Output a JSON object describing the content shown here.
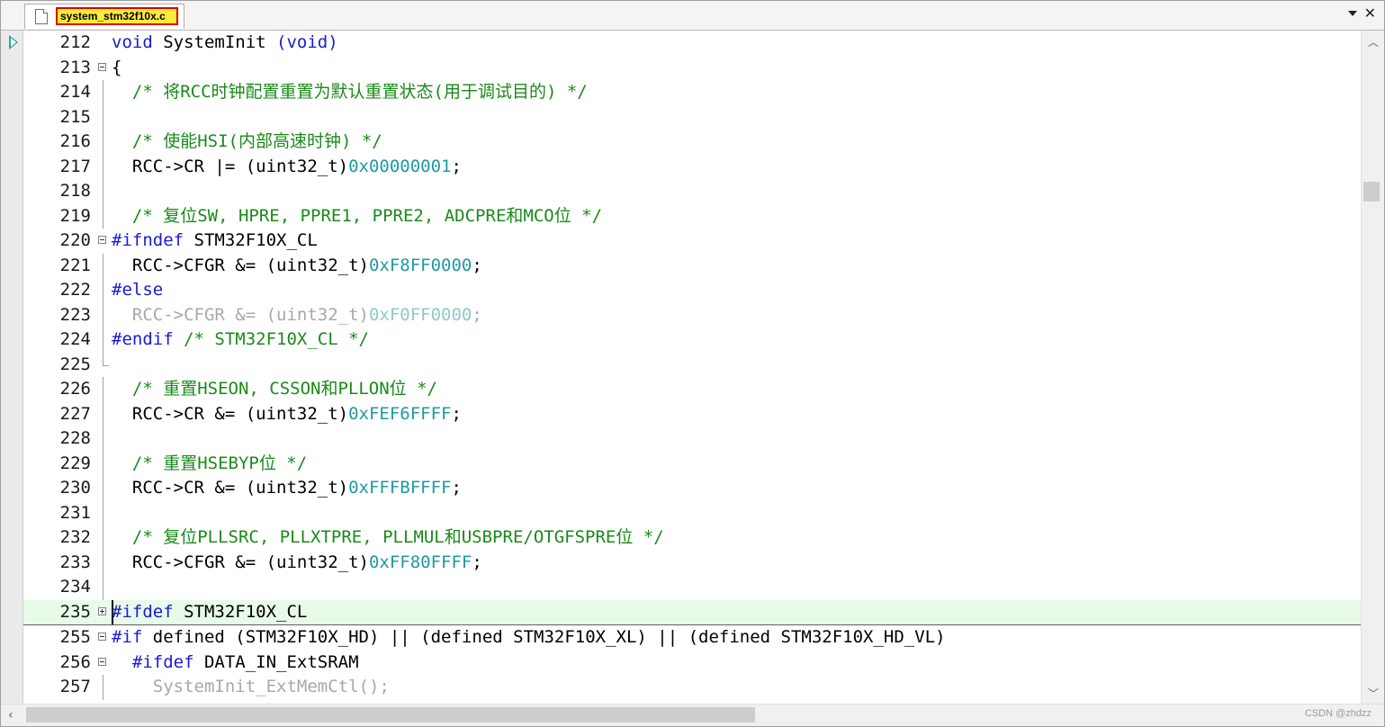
{
  "tab": {
    "filename": "system_stm32f10x.c",
    "icon": "file-icon"
  },
  "lines": [
    {
      "no": "212",
      "fold": "",
      "tokens": [
        [
          "kw",
          "void"
        ],
        [
          "t",
          " SystemInit "
        ],
        [
          "kw",
          "(void)"
        ]
      ]
    },
    {
      "no": "213",
      "fold": "minus",
      "tokens": [
        [
          "t",
          "{"
        ]
      ]
    },
    {
      "no": "214",
      "fold": "line",
      "tokens": [
        [
          "t",
          "  "
        ],
        [
          "cm",
          "/* 将RCC时钟配置重置为默认重置状态(用于调试目的) */"
        ]
      ]
    },
    {
      "no": "215",
      "fold": "line",
      "tokens": []
    },
    {
      "no": "216",
      "fold": "line",
      "tokens": [
        [
          "t",
          "  "
        ],
        [
          "cm",
          "/* 使能HSI(内部高速时钟) */"
        ]
      ]
    },
    {
      "no": "217",
      "fold": "line",
      "tokens": [
        [
          "t",
          "  RCC->CR |= (uint32_t)"
        ],
        [
          "num",
          "0x00000001"
        ],
        [
          "t",
          ";"
        ]
      ]
    },
    {
      "no": "218",
      "fold": "line",
      "tokens": []
    },
    {
      "no": "219",
      "fold": "line",
      "tokens": [
        [
          "t",
          "  "
        ],
        [
          "cm",
          "/* 复位SW, HPRE, PPRE1, PPRE2, ADCPRE和MCO位 */"
        ]
      ]
    },
    {
      "no": "220",
      "fold": "minus",
      "tokens": [
        [
          "pp",
          "#ifndef"
        ],
        [
          "t",
          " STM32F10X_CL"
        ]
      ]
    },
    {
      "no": "221",
      "fold": "line",
      "tokens": [
        [
          "t",
          "  RCC->CFGR &= (uint32_t)"
        ],
        [
          "num",
          "0xF8FF0000"
        ],
        [
          "t",
          ";"
        ]
      ]
    },
    {
      "no": "222",
      "fold": "line",
      "tokens": [
        [
          "pp",
          "#else"
        ]
      ]
    },
    {
      "no": "223",
      "fold": "line",
      "tokens": [
        [
          "dim",
          "  RCC->CFGR &= (uint32_t)"
        ],
        [
          "dimnum",
          "0xF0FF0000"
        ],
        [
          "dim",
          ";"
        ]
      ]
    },
    {
      "no": "224",
      "fold": "line",
      "tokens": [
        [
          "pp",
          "#endif"
        ],
        [
          "t",
          " "
        ],
        [
          "cm",
          "/* STM32F10X_CL */"
        ]
      ]
    },
    {
      "no": "225",
      "fold": "end",
      "tokens": []
    },
    {
      "no": "226",
      "fold": "line",
      "tokens": [
        [
          "t",
          "  "
        ],
        [
          "cm",
          "/* 重置HSEON, CSSON和PLLON位 */"
        ]
      ]
    },
    {
      "no": "227",
      "fold": "line",
      "tokens": [
        [
          "t",
          "  RCC->CR &= (uint32_t)"
        ],
        [
          "num",
          "0xFEF6FFFF"
        ],
        [
          "t",
          ";"
        ]
      ]
    },
    {
      "no": "228",
      "fold": "line",
      "tokens": []
    },
    {
      "no": "229",
      "fold": "line",
      "tokens": [
        [
          "t",
          "  "
        ],
        [
          "cm",
          "/* 重置HSEBYP位 */"
        ]
      ]
    },
    {
      "no": "230",
      "fold": "line",
      "tokens": [
        [
          "t",
          "  RCC->CR &= (uint32_t)"
        ],
        [
          "num",
          "0xFFFBFFFF"
        ],
        [
          "t",
          ";"
        ]
      ]
    },
    {
      "no": "231",
      "fold": "line",
      "tokens": []
    },
    {
      "no": "232",
      "fold": "line",
      "tokens": [
        [
          "t",
          "  "
        ],
        [
          "cm",
          "/* 复位PLLSRC, PLLXTPRE, PLLMUL和USBPRE/OTGFSPRE位 */"
        ]
      ]
    },
    {
      "no": "233",
      "fold": "line",
      "tokens": [
        [
          "t",
          "  RCC->CFGR &= (uint32_t)"
        ],
        [
          "num",
          "0xFF80FFFF"
        ],
        [
          "t",
          ";"
        ]
      ]
    },
    {
      "no": "234",
      "fold": "line",
      "tokens": []
    },
    {
      "no": "235",
      "fold": "plus",
      "hl": true,
      "tokens": [
        [
          "pp",
          "#ifdef"
        ],
        [
          "t",
          " STM32F10X_CL"
        ]
      ]
    },
    {
      "no": "255",
      "fold": "minus",
      "tokens": [
        [
          "pp",
          "#if"
        ],
        [
          "t",
          " defined (STM32F10X_HD) || (defined STM32F10X_XL) || (defined STM32F10X_HD_VL)"
        ]
      ]
    },
    {
      "no": "256",
      "fold": "minus",
      "tokens": [
        [
          "t",
          "  "
        ],
        [
          "pp",
          "#ifdef"
        ],
        [
          "t",
          " DATA_IN_ExtSRAM"
        ]
      ]
    },
    {
      "no": "257",
      "fold": "line",
      "tokens": [
        [
          "dim",
          "    SystemInit_ExtMemCtl();"
        ]
      ]
    }
  ],
  "watermark": "CSDN @zhdzz"
}
